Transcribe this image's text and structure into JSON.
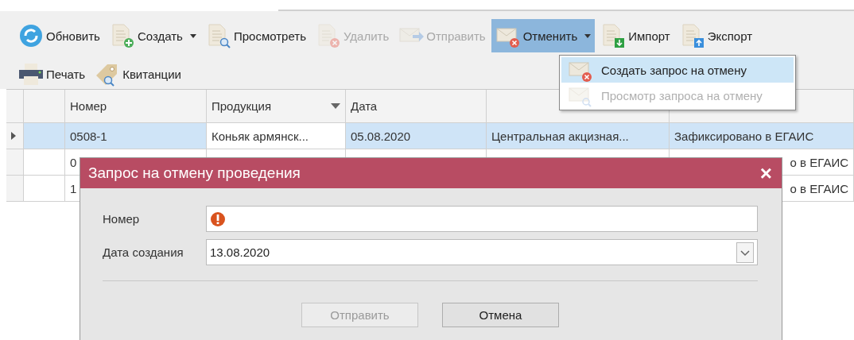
{
  "toolbar": {
    "rows": [
      [
        {
          "label": "Обновить",
          "kind": "refresh",
          "disabled": false,
          "dropdown": false,
          "selected": false
        },
        {
          "label": "Создать",
          "kind": "doc-plus",
          "disabled": false,
          "dropdown": true,
          "selected": false
        },
        {
          "label": "Просмотреть",
          "kind": "doc-search",
          "disabled": false,
          "dropdown": false,
          "selected": false
        },
        {
          "label": "Удалить",
          "kind": "doc-delete",
          "disabled": true,
          "dropdown": false,
          "selected": false
        },
        {
          "label": "Отправить",
          "kind": "mail-send",
          "disabled": true,
          "dropdown": false,
          "selected": false
        },
        {
          "label": "Отменить",
          "kind": "mail-cancel",
          "disabled": false,
          "dropdown": true,
          "selected": true
        },
        {
          "label": "Импорт",
          "kind": "doc-import",
          "disabled": false,
          "dropdown": false,
          "selected": false
        },
        {
          "label": "Экспорт",
          "kind": "doc-export",
          "disabled": false,
          "dropdown": false,
          "selected": false
        }
      ],
      [
        {
          "label": "Печать",
          "kind": "printer",
          "disabled": false,
          "dropdown": false,
          "selected": false
        },
        {
          "label": "Квитанции",
          "kind": "tag-search",
          "disabled": false,
          "dropdown": false,
          "selected": false
        }
      ]
    ]
  },
  "menu": {
    "items": [
      {
        "label": "Создать запрос на отмену",
        "kind": "mail-cancel",
        "selected": true,
        "disabled": false
      },
      {
        "label": "Просмотр запроса на отмену",
        "kind": "mail-search",
        "selected": false,
        "disabled": true
      }
    ]
  },
  "table": {
    "columns": [
      {
        "label": "Номер",
        "filter": false
      },
      {
        "label": "Продукция",
        "filter": true
      },
      {
        "label": "Дата",
        "filter": false
      }
    ],
    "rows": [
      {
        "kind": "full",
        "selected": true,
        "current": true,
        "product_focused": true,
        "number": "0508-1",
        "product": "Коньяк армянск...",
        "date": "05.08.2020",
        "post": "Центральная акцизная...",
        "status": "Зафиксировано в ЕГАИС"
      },
      {
        "kind": "covered",
        "selected": false,
        "current": false,
        "number": "0",
        "status": "о в ЕГАИС"
      },
      {
        "kind": "covered",
        "selected": false,
        "current": false,
        "number": "1",
        "status": "о в ЕГАИС"
      }
    ]
  },
  "dialog": {
    "title": "Запрос на отмену проведения",
    "close": "×",
    "fields": [
      {
        "kind": "text",
        "label": "Номер",
        "invalid": true
      },
      {
        "kind": "dropdown",
        "label": "Дата создания",
        "value": "13.08.2020",
        "invalid": false
      }
    ],
    "buttons": [
      {
        "label": "Отправить",
        "disabled": true
      },
      {
        "label": "Отмена",
        "disabled": false
      }
    ]
  }
}
